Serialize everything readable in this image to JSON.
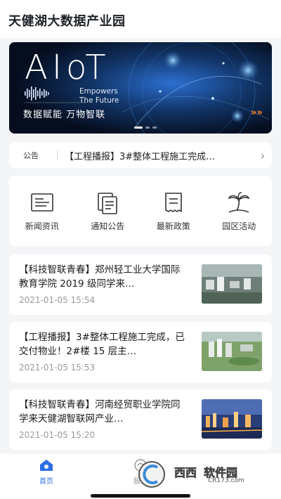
{
  "header": {
    "title": "天健湖大数据产业园"
  },
  "banner": {
    "logo_text": "AIoT",
    "sub_line1": "Empowers",
    "sub_line2": "The Future",
    "slogan": "数据赋能  万物智联",
    "arrows": "»»"
  },
  "notice": {
    "tag": "公告",
    "text": "【工程播报】3#整体工程施工完成…",
    "arrow": "›"
  },
  "quick_links": [
    {
      "label": "新闻资讯",
      "icon": "newspaper-icon"
    },
    {
      "label": "通知公告",
      "icon": "notice-doc-icon"
    },
    {
      "label": "最新政策",
      "icon": "policy-doc-icon"
    },
    {
      "label": "园区活动",
      "icon": "palm-tree-icon"
    }
  ],
  "news": [
    {
      "title": "【科技智联青春】郑州轻工业大学国际教育学院 2019 级同学来…",
      "date": "2021-01-05 15:54"
    },
    {
      "title": "【工程播报】3#整体工程施工完成，已交付物业！2#楼 15 层主…",
      "date": "2021-01-05 15:53"
    },
    {
      "title": "【科技智联青春】河南经贸职业学院同学来天健湖智联网产业…",
      "date": "2021-01-05 15:20"
    }
  ],
  "tabbar": {
    "home": "首页",
    "service": "服务"
  },
  "watermark": {
    "text1": "西西",
    "text2": "软件园",
    "url": "CR173.com"
  },
  "colors": {
    "accent": "#2f6fe4",
    "banner_bg": "#0a1630"
  }
}
